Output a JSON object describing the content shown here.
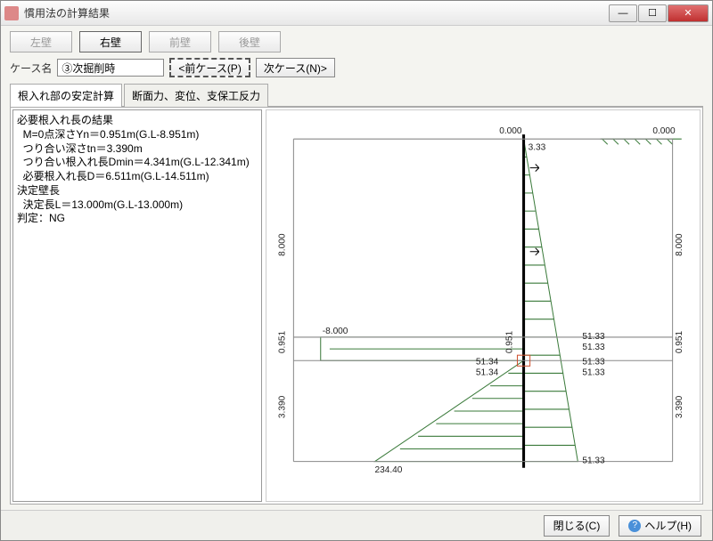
{
  "window": {
    "title": "慣用法の計算結果"
  },
  "walls": {
    "left": "左壁",
    "right": "右壁",
    "front": "前壁",
    "back": "後壁",
    "active": "right"
  },
  "case": {
    "label": "ケース名",
    "value": "③次掘削時",
    "prev": "<前ケース(P)",
    "next": "次ケース(N)>"
  },
  "tabs": {
    "t1": "根入れ部の安定計算",
    "t2": "断面力、変位、支保工反力",
    "active": "t1"
  },
  "results": {
    "l1": "必要根入れ長の結果",
    "l2": "  M=0点深さYn＝0.951m(G.L-8.951m)",
    "l3": "  つり合い深さtn＝3.390m",
    "l4": "  つり合い根入れ長Dmin＝4.341m(G.L-12.341m)",
    "l5": "  必要根入れ長D＝6.511m(G.L-14.511m)",
    "l6": "決定壁長",
    "l7": "  決定長L＝13.000m(G.L-13.000m)",
    "l8": "判定：NG"
  },
  "chart_data": {
    "type": "diagram",
    "top_left": "0.000",
    "top_right": "0.000",
    "near_top_center": "3.33",
    "left_8": "8.000",
    "right_8": "8.000",
    "left_neg8": "-8.000",
    "val_51_33": "51.33",
    "val_51_34": "51.34",
    "d0951_l": "0.951",
    "d0951_r": "0.951",
    "d3390_l": "3.390",
    "d3390_r": "3.390",
    "bottom_234": "234.40"
  },
  "footer": {
    "close": "閉じる(C)",
    "help": "ヘルプ(H)"
  }
}
